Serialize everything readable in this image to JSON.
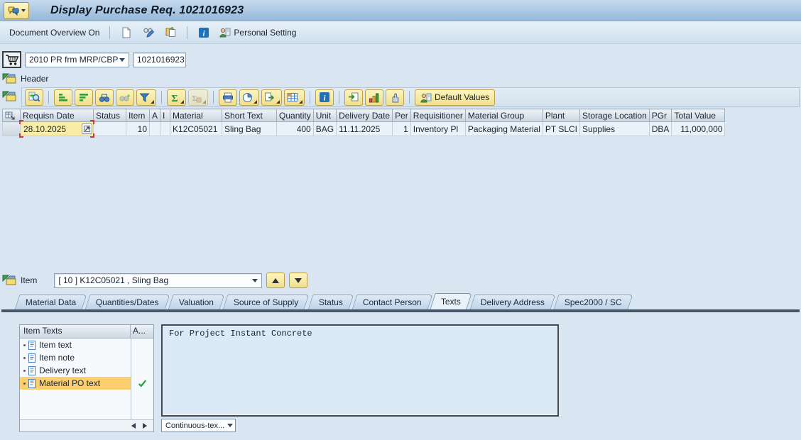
{
  "window": {
    "title": "Display Purchase Req. 1021016923"
  },
  "app_toolbar": {
    "document_overview_label": "Document Overview On",
    "personal_setting_label": "Personal Setting"
  },
  "doc_header": {
    "doc_type_value": "2010 PR frm MRP/CBP",
    "doc_number_value": "1021016923",
    "header_label": "Header"
  },
  "grid": {
    "default_values_label": "Default Values",
    "columns": [
      "Requisn Date",
      "Status",
      "Item",
      "A",
      "I",
      "Material",
      "Short Text",
      "Quantity",
      "Unit",
      "Delivery Date",
      "Per",
      "Requisitioner",
      "Material Group",
      "Plant",
      "Storage Location",
      "PGr",
      "Total Value"
    ],
    "row_values": [
      "28.10.2025",
      "",
      "10",
      "",
      "",
      "K12C05021",
      "Sling Bag",
      "400",
      "BAG",
      "11.11.2025",
      "1",
      "Inventory Pl",
      "Packaging Material",
      "PT SLCI",
      "Supplies",
      "DBA",
      "11,000,000"
    ]
  },
  "item_section": {
    "item_label": "Item",
    "item_selector_value": "[ 10 ] K12C05021 , Sling Bag",
    "tabs": [
      "Material Data",
      "Quantities/Dates",
      "Valuation",
      "Source of Supply",
      "Status",
      "Contact Person",
      "Texts",
      "Delivery Address",
      "Spec2000 / SC"
    ],
    "active_tab": "Texts",
    "texts_tab": {
      "list_title": "Item Texts",
      "status_column_title": "A...",
      "text_types": [
        "Item text",
        "Item note",
        "Delivery text",
        "Material PO text"
      ],
      "selected_type": "Material PO text",
      "editor_text": "For Project Instant Concrete",
      "format_value": "Continuous-tex..."
    }
  },
  "colors": {
    "titlebar_top": "#c6daee",
    "titlebar_bottom": "#95b8da",
    "button_yellow": "#f4e59a",
    "selection_yellow": "#f8eca6",
    "highlight_orange": "#fbcf6d",
    "check_green": "#2f9e44",
    "tab_line_dark": "#46586a",
    "background": "#d9e6f2"
  }
}
